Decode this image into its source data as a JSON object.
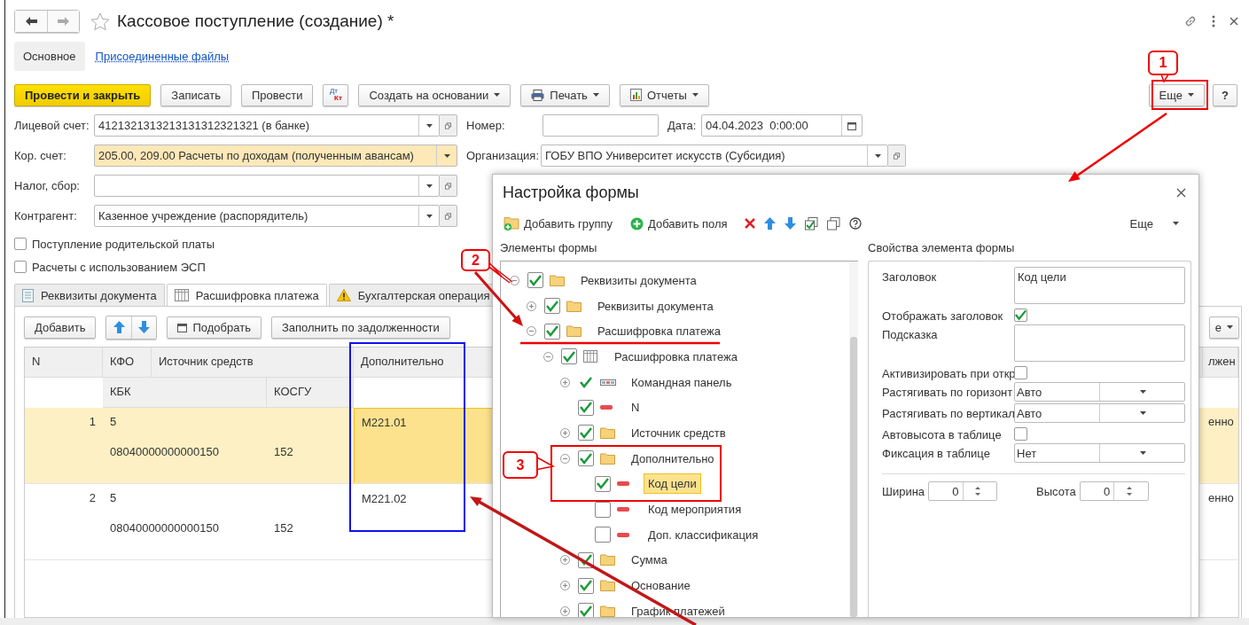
{
  "window": {
    "title": "Кассовое поступление (создание) *"
  },
  "top_tabs": [
    {
      "label": "Основное",
      "selected": true
    },
    {
      "label": "Присоединенные файлы",
      "selected": false
    }
  ],
  "command_bar": {
    "buttons": [
      {
        "label": "Провести и закрыть",
        "kind": "primary"
      },
      {
        "label": "Записать",
        "kind": "plain"
      },
      {
        "label": "Провести",
        "kind": "plain"
      },
      {
        "kind": "dt-kt",
        "label_top": "Дт",
        "label_bottom": "Кт"
      },
      {
        "label": "Создать на основании",
        "kind": "plain",
        "dropdown": true
      },
      {
        "label": "Печать",
        "kind": "plain",
        "dropdown": true
      },
      {
        "label": "Отчеты",
        "kind": "plain",
        "dropdown": true
      }
    ],
    "more": "Еще",
    "help": "?"
  },
  "fields_left": [
    {
      "label": "Лицевой счет:",
      "value": "4121321313213131312321321 (в банке)",
      "open_button": true,
      "highlighted": false
    },
    {
      "label": "Кор. счет:",
      "value": "205.00, 209.00 Расчеты по доходам (полученным авансам)",
      "open_button": false,
      "highlighted": true
    },
    {
      "label": "Налог, сбор:",
      "open_button": true,
      "highlighted": false
    },
    {
      "label": "Контрагент:",
      "value": "Казенное учреждение (распорядитель)",
      "open_button": true,
      "highlighted": false
    }
  ],
  "number": {
    "label": "Номер:"
  },
  "date": {
    "label": "Дата:",
    "value": "04.04.2023  0:00:00"
  },
  "organization": {
    "label": "Организация:",
    "value": "ГОБУ ВПО Университет искусств (Субсидия)"
  },
  "checkboxes": [
    {
      "label": "Поступление родительской платы",
      "checked": false
    },
    {
      "label": "Расчеты с использованием ЭСП",
      "checked": false
    }
  ],
  "tabs": [
    {
      "label": "Реквизиты документа",
      "selected": false
    },
    {
      "label": "Расшифровка платежа",
      "selected": true
    },
    {
      "label": "Бухгалтерская операция",
      "selected": false
    }
  ],
  "table_toolbar": {
    "add": "Добавить",
    "pick": "Подобрать",
    "fill": "Заполнить по задолженности",
    "more_fragment": "е"
  },
  "table": {
    "header": {
      "n": "N",
      "kfo": "КФО",
      "source": "Источник средств",
      "kbk": "КБК",
      "kosgu": "КОСГУ",
      "extra": "Дополнительно",
      "column_7": "лжен"
    },
    "rows": [
      {
        "n": "1",
        "kfo": "5",
        "kbk": "08040000000000150",
        "kosgu": "152",
        "extra": "M221.01",
        "column_7": "енно",
        "selected": true
      },
      {
        "n": "2",
        "kfo": "5",
        "kbk": "08040000000000150",
        "kosgu": "152",
        "extra": "M221.02",
        "column_7": "енно",
        "selected": false
      }
    ]
  },
  "dialog": {
    "title": "Настройка формы",
    "toolbar": [
      "Добавить группу",
      "Добавить поля"
    ],
    "more": "Еще",
    "tree_title": "Элементы формы",
    "properties_title": "Свойства элемента формы",
    "tree": [
      {
        "label": "Реквизиты документа",
        "kind": "folder",
        "checked": true,
        "expanded": true,
        "selected": false,
        "children": [
          {
            "label": "Реквизиты документа",
            "kind": "folder",
            "checked": true,
            "expanded": false,
            "selected": false
          },
          {
            "label": "Расшифровка платежа",
            "kind": "folder",
            "checked": true,
            "expanded": true,
            "selected": false,
            "children": [
              {
                "label": "Расшифровка платежа",
                "kind": "table",
                "checked": true,
                "expanded": true,
                "selected": false,
                "children": [
                  {
                    "label": "Командная панель",
                    "kind": "command-panel",
                    "checked": true,
                    "expanded": false,
                    "selected": false
                  },
                  {
                    "label": "N",
                    "kind": "field",
                    "checked": true,
                    "selected": false
                  },
                  {
                    "label": "Источник средств",
                    "kind": "folder",
                    "checked": true,
                    "expanded": false,
                    "selected": false
                  },
                  {
                    "label": "Дополнительно",
                    "kind": "folder",
                    "checked": true,
                    "expanded": true,
                    "selected": false,
                    "children": [
                      {
                        "label": "Код цели",
                        "kind": "field",
                        "checked": true,
                        "selected": true
                      },
                      {
                        "label": "Код мероприятия",
                        "kind": "field",
                        "checked": false,
                        "selected": false
                      },
                      {
                        "label": "Доп. классификация",
                        "kind": "field",
                        "checked": false,
                        "selected": false
                      }
                    ]
                  },
                  {
                    "label": "Сумма",
                    "kind": "folder",
                    "checked": true,
                    "expanded": false,
                    "selected": false
                  },
                  {
                    "label": "Основание",
                    "kind": "folder",
                    "checked": true,
                    "expanded": false,
                    "selected": false
                  },
                  {
                    "label": "График платежей",
                    "kind": "folder",
                    "checked": true,
                    "expanded": false,
                    "selected": false
                  }
                ]
              }
            ]
          }
        ]
      }
    ],
    "properties": [
      {
        "kind": "textarea",
        "label": "Заголовок",
        "value": "Код цели"
      },
      {
        "kind": "checkbox",
        "label": "Отображать заголовок",
        "checked": true
      },
      {
        "kind": "textarea",
        "label": "Подсказка"
      },
      {
        "kind": "checkbox",
        "label": "Активизировать при откр",
        "checked": false
      },
      {
        "kind": "select",
        "label": "Растягивать по горизонт",
        "value": "Авто"
      },
      {
        "kind": "select",
        "label": "Растягивать по вертикал",
        "value": "Авто"
      },
      {
        "kind": "checkbox",
        "label": "Автовысота в таблице",
        "checked": false
      },
      {
        "kind": "select",
        "label": "Фиксация в таблице",
        "value": "Нет"
      }
    ],
    "size": [
      {
        "label": "Ширина",
        "value": "0"
      },
      {
        "label": "Высота",
        "value": "0"
      }
    ]
  },
  "annotations": [
    {
      "label": "1"
    },
    {
      "label": "2"
    },
    {
      "label": "3"
    }
  ]
}
